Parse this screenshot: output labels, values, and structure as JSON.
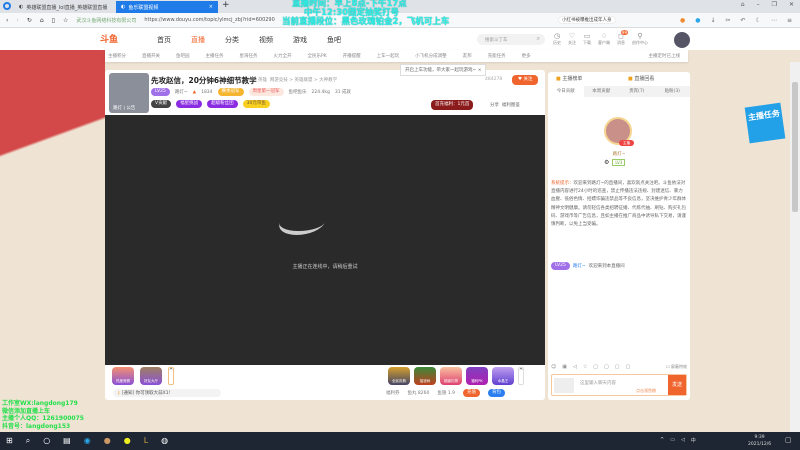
{
  "browser": {
    "tabs": [
      {
        "label": "英雄联盟直播_lol直播_英雄联盟直播"
      },
      {
        "label": "鱼乐联盟视频"
      }
    ],
    "new_tab": "+",
    "url_org": "武汉斗鱼网络科技有限公司",
    "url": "https://www.douyu.com/topic/ylmcj_zbj?rid=600290",
    "search_text": "小红书被曝推出成年人身"
  },
  "overlay_text": [
    "直播时间：早上8点-下午17点",
    "中午12:30固定抽奖打号",
    "当前直播段位：黑色玫瑰铂金2，飞机可上车"
  ],
  "site": {
    "logo": "斗鱼",
    "nav": [
      "首页",
      "直播",
      "分类",
      "视频",
      "游戏",
      "鱼吧"
    ],
    "search_placeholder": "搜索斗丁车",
    "icons": [
      "历史",
      "关注",
      "下载",
      "客户端",
      "消息",
      "创作中心"
    ],
    "msg_badge": "99",
    "sub_nav": [
      "主播积分",
      "直播开关",
      "鱼吧园",
      "主播任务",
      "星海任务",
      "火力全开",
      "全民乐PK",
      "开播提醒",
      "上车一起玩",
      "小飞机分成调整",
      "友邦",
      "充能任务",
      "更多"
    ],
    "sub_right": "主播定时已上线"
  },
  "tooltip": "开启上车功能，带大家一起玩游戏~ ×",
  "room": {
    "title": "先攻赵信，20分钟6神细节教学",
    "category": "英雄",
    "tags": "网游竞技 > 英雄联盟 > 大神教学",
    "level": "LV25",
    "anchor": "路灯~",
    "heat": "1834",
    "badge1": "赛季冠军",
    "badge2": "周星第一冠军",
    "fans": "鱼吧鱼乐",
    "weight": "224.4kg",
    "reports": "31 成就",
    "room_id": "484278",
    "follow": "关注",
    "avatar_label": "路灯 | 公告",
    "buttons": [
      "V贡献",
      "福星挑战",
      "超级粉丝团",
      "30元带鱼"
    ],
    "welfare": "首充福利：1元首",
    "share": "分享",
    "welfare_map": "福利图鉴",
    "stream_msg": "主播正在连线中，请稍后重试"
  },
  "gift_bar": {
    "left": [
      "热度竞赛",
      "好友大厅"
    ],
    "right": [
      "全民庆典",
      "摇钱树",
      "超级礼物",
      "福利PK",
      "水晶王"
    ],
    "notice": "[通知] 你可领取大蒜X1!",
    "welfare_list": "福利券",
    "fish_balls": "鱼丸 8260",
    "fish_wings": "鱼翅 1.9",
    "recharge": "充值",
    "backpack": "背包"
  },
  "side": {
    "rank": "主播榜单",
    "replay": "直播回看",
    "tabs": [
      "今日贡献",
      "本周贡献",
      "贵宾(7)",
      "贴粉(3)"
    ],
    "top_user": "路灯~",
    "top_tag": "LV3",
    "user_badge": "主播",
    "system_label": "系统提示：",
    "system_msg": "欢迎来到路灯~的直播间，喜欢就点关注吧。斗鱼依法对直播内容进行24小时的巡查，禁止传播违法违规、封建迷信、暴力血腥、低俗色情、招嫖诈骗违禁品等不良信息，坚决维护青少年群体精神文明健康。请勿轻信各类招聘征婚、代练代抽、刷钻、购买礼包码、游戏币等广告信息，且如主播在推广商品中诱导私下交易，请谨慎判断，以免上当受骗。",
    "welcome_level": "LV25",
    "welcome_user": "路灯~",
    "welcome_msg": "欢迎来到本直播间",
    "block_fx": "屏蔽特效",
    "chat_placeholder": "这里输入聊天内容",
    "chat_tag": "点击领鱼粮",
    "send": "发送",
    "task_label": "主播任务"
  },
  "watermark": [
    "工作室WX:langdong179",
    "微信添加直播上车",
    "主播个人QQ：1261900075",
    "抖音号：langdong153"
  ],
  "taskbar": {
    "time": "9:39",
    "date": "2021/12/6",
    "ime": "中"
  }
}
